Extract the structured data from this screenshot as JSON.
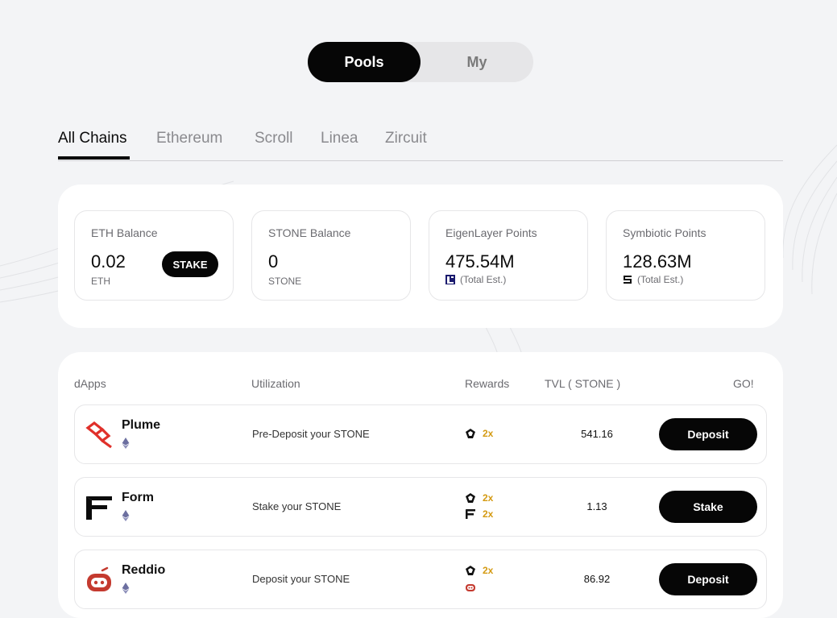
{
  "toggle": {
    "active": "Pools",
    "inactive": "My"
  },
  "chains": [
    "All Chains",
    "Ethereum",
    "Scroll",
    "Linea",
    "Zircuit"
  ],
  "balances": [
    {
      "label": "ETH Balance",
      "value": "0.02",
      "unit": "ETH",
      "button": "STAKE"
    },
    {
      "label": "STONE Balance",
      "value": "0",
      "unit": "STONE"
    },
    {
      "label": "EigenLayer Points",
      "value": "475.54M",
      "unit": "(Total Est.)",
      "icon": "eigenlayer-icon"
    },
    {
      "label": "Symbiotic Points",
      "value": "128.63M",
      "unit": "(Total Est.)",
      "icon": "symbiotic-icon"
    }
  ],
  "table": {
    "headers": {
      "dapps": "dApps",
      "utilization": "Utilization",
      "rewards": "Rewards",
      "tvl": "TVL ( STONE )",
      "go": "GO!"
    },
    "rows": [
      {
        "name": "Plume",
        "utilization": "Pre-Deposit your STONE",
        "rewards": [
          "2x"
        ],
        "tvl": "541.16",
        "action": "Deposit",
        "logo": "plume-logo"
      },
      {
        "name": "Form",
        "utilization": "Stake your STONE",
        "rewards": [
          "2x",
          "2x"
        ],
        "tvl": "1.13",
        "action": "Stake",
        "logo": "form-logo"
      },
      {
        "name": "Reddio",
        "utilization": "Deposit your STONE",
        "rewards": [
          "2x",
          ""
        ],
        "tvl": "86.92",
        "action": "Deposit",
        "logo": "reddio-logo"
      }
    ]
  },
  "colors": {
    "accent": "#060606",
    "reward": "#d49a12",
    "plume": "#e0302a",
    "reddio": "#c43a2f"
  }
}
